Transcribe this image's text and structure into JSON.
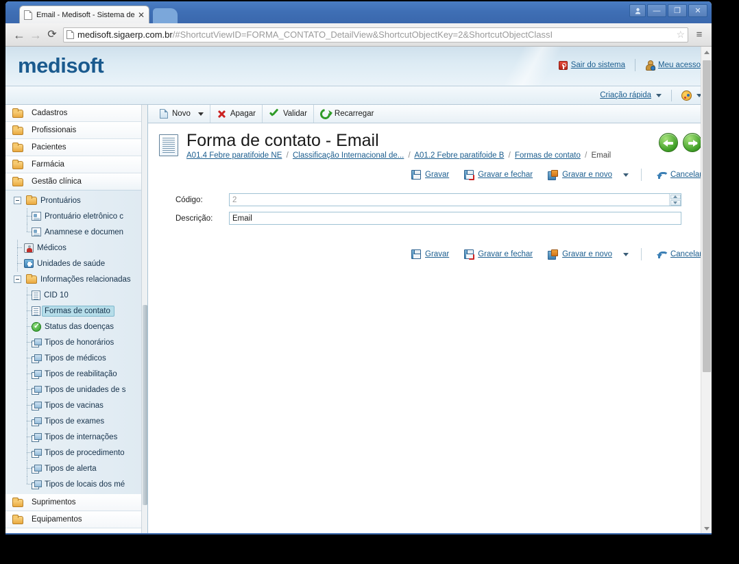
{
  "browser": {
    "tab_title": "Email - Medisoft - Sistema de",
    "tab_close": "✕",
    "back_icon": "←",
    "forward_icon": "→",
    "reload_icon": "⟳",
    "url_dark": "medisoft.sigaerp.com.br",
    "url_grey": "/#ShortcutViewID=FORMA_CONTATO_DetailView&ShortcutObjectKey=2&ShortcutObjectClassI",
    "star_icon": "☆",
    "menu_icon": "≡",
    "window_buttons": {
      "user": "A",
      "minimize": "—",
      "restore": "❐",
      "close": "✕"
    }
  },
  "app_header": {
    "logo": "medisoft",
    "logout_label": "Sair do sistema",
    "account_label": "Meu acesso",
    "quick_create_label": "Criação rápida",
    "theme_label": ""
  },
  "toolbar": {
    "new_label": "Novo",
    "delete_label": "Apagar",
    "validate_label": "Validar",
    "reload_label": "Recarregar"
  },
  "content": {
    "page_title": "Forma de contato - Email",
    "breadcrumb": [
      {
        "label": "A01.4 Febre paratifoide NE",
        "link": true
      },
      {
        "label": "Classificação Internacional de...",
        "link": true
      },
      {
        "label": "A01.2 Febre paratifoide B",
        "link": true
      },
      {
        "label": "Formas de contato",
        "link": true
      },
      {
        "label": "Email",
        "link": false
      }
    ],
    "breadcrumb_separator": "/",
    "nav_prev_title": "Anterior",
    "nav_next_title": "Próximo"
  },
  "actions": {
    "save_label": "Gravar",
    "save_close_label": "Gravar e fechar",
    "save_new_label": "Gravar e novo",
    "cancel_label": "Cancelar"
  },
  "form": {
    "code_label": "Código:",
    "code_value": "2",
    "description_label": "Descrição:",
    "description_value": "Email"
  },
  "sidebar": {
    "groups": [
      {
        "label": "Cadastros",
        "icon": "folder-icon"
      },
      {
        "label": "Profissionais",
        "icon": "folder-icon"
      },
      {
        "label": "Pacientes",
        "icon": "folder-icon"
      },
      {
        "label": "Farmácia",
        "icon": "folder-icon"
      },
      {
        "label": "Gestão clínica",
        "icon": "folder-icon"
      }
    ],
    "tree": [
      {
        "label": "Prontuários",
        "icon": "folder-icon",
        "level": 1,
        "expander": true
      },
      {
        "label": "Prontuário eletrônico c",
        "icon": "card-icon",
        "level": 2
      },
      {
        "label": "Anamnese e documen",
        "icon": "card-icon",
        "level": 2
      },
      {
        "label": "Médicos",
        "icon": "doctor-icon",
        "level": 1
      },
      {
        "label": "Unidades de saúde",
        "icon": "hospital-icon",
        "level": 1
      },
      {
        "label": "Informações relacionadas",
        "icon": "folder-icon",
        "level": 1,
        "expander": true
      },
      {
        "label": "CID 10",
        "icon": "document-icon",
        "level": 2
      },
      {
        "label": "Formas de contato",
        "icon": "document-icon",
        "level": 2,
        "selected": true
      },
      {
        "label": "Status das doenças",
        "icon": "check-icon",
        "level": 2
      },
      {
        "label": "Tipos de honorários",
        "icon": "stack-icon",
        "level": 2
      },
      {
        "label": "Tipos de médicos",
        "icon": "stack-icon",
        "level": 2
      },
      {
        "label": "Tipos de reabilitação",
        "icon": "stack-icon",
        "level": 2
      },
      {
        "label": "Tipos de unidades de s",
        "icon": "stack-icon",
        "level": 2
      },
      {
        "label": "Tipos de vacinas",
        "icon": "stack-icon",
        "level": 2
      },
      {
        "label": "Tipos de exames",
        "icon": "stack-icon",
        "level": 2
      },
      {
        "label": "Tipos de internações",
        "icon": "stack-icon",
        "level": 2
      },
      {
        "label": "Tipos de procedimento",
        "icon": "stack-icon",
        "level": 2
      },
      {
        "label": "Tipos de alerta",
        "icon": "stack-icon",
        "level": 2
      },
      {
        "label": "Tipos de locais dos mé",
        "icon": "stack-icon",
        "level": 2,
        "last": true
      }
    ],
    "groups_bottom": [
      {
        "label": "Suprimentos",
        "icon": "folder-icon"
      },
      {
        "label": "Equipamentos",
        "icon": "folder-icon"
      }
    ]
  },
  "colors": {
    "brand": "#1a5a8e",
    "link": "#1b5d8e",
    "selection": "#b6dde9",
    "header_gradient_start": "#cfe0ec",
    "header_gradient_end": "#eaf3f9"
  }
}
